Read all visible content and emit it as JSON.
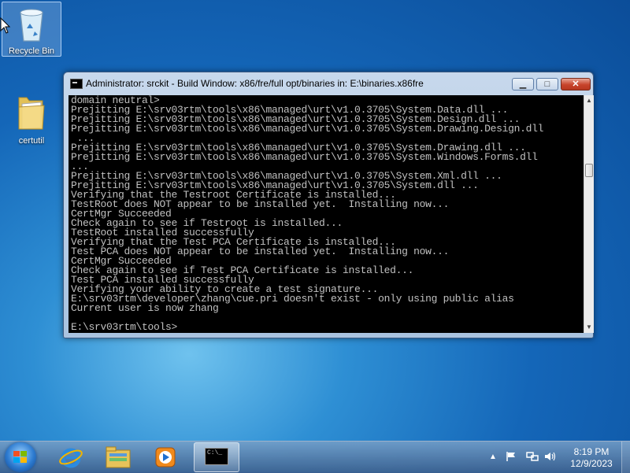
{
  "desktop": {
    "icons": [
      {
        "label": "Recycle Bin"
      },
      {
        "label": "certutil"
      }
    ]
  },
  "console_window": {
    "title": "Administrator:  srckit - Build Window: x86/fre/full opt/binaries in: E:\\binaries.x86fre",
    "minimize_glyph": "▁",
    "maximize_glyph": "□",
    "close_glyph": "✕",
    "lines": [
      "domain neutral>",
      "Prejitting E:\\srv03rtm\\tools\\x86\\managed\\urt\\v1.0.3705\\System.Data.dll ...",
      "Prejitting E:\\srv03rtm\\tools\\x86\\managed\\urt\\v1.0.3705\\System.Design.dll ...",
      "Prejitting E:\\srv03rtm\\tools\\x86\\managed\\urt\\v1.0.3705\\System.Drawing.Design.dll",
      " ...",
      "Prejitting E:\\srv03rtm\\tools\\x86\\managed\\urt\\v1.0.3705\\System.Drawing.dll ...",
      "Prejitting E:\\srv03rtm\\tools\\x86\\managed\\urt\\v1.0.3705\\System.Windows.Forms.dll",
      "...",
      "Prejitting E:\\srv03rtm\\tools\\x86\\managed\\urt\\v1.0.3705\\System.Xml.dll ...",
      "Prejitting E:\\srv03rtm\\tools\\x86\\managed\\urt\\v1.0.3705\\System.dll ...",
      "Verifying that the Testroot Certificate is installed...",
      "TestRoot does NOT appear to be installed yet.  Installing now...",
      "CertMgr Succeeded",
      "Check again to see if Testroot is installed...",
      "TestRoot installed successfully",
      "Verifying that the Test PCA Certificate is installed...",
      "Test PCA does NOT appear to be installed yet.  Installing now...",
      "CertMgr Succeeded",
      "Check again to see if Test PCA Certificate is installed...",
      "Test PCA installed successfully",
      "Verifying your ability to create a test signature...",
      "E:\\srv03rtm\\developer\\zhang\\cue.pri doesn't exist - only using public alias",
      "Current user is now zhang",
      "",
      "E:\\srv03rtm\\tools>"
    ]
  },
  "taskbar": {
    "cmd_icon_text": "C:\\_",
    "clock_time": "8:19 PM",
    "clock_date": "12/9/2023",
    "tray_icons": [
      "show-hidden-icons-arrow",
      "flag-icon",
      "network-icon",
      "volume-icon"
    ]
  }
}
